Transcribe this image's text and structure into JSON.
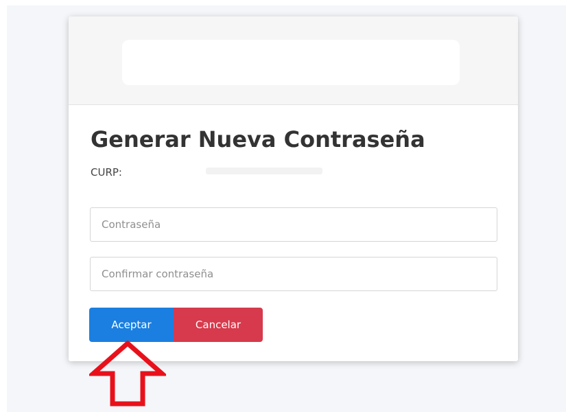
{
  "dialog": {
    "title": "Generar Nueva Contraseña",
    "curp_label": "CURP:",
    "password_placeholder": "Contraseña",
    "confirm_placeholder": "Confirmar contraseña",
    "accept_label": "Aceptar",
    "cancel_label": "Cancelar"
  },
  "annotation": {
    "arrow_color": "#e8111b",
    "arrow_direction": "up"
  },
  "colors": {
    "accept": "#1a7fe0",
    "cancel": "#d63a4c"
  }
}
